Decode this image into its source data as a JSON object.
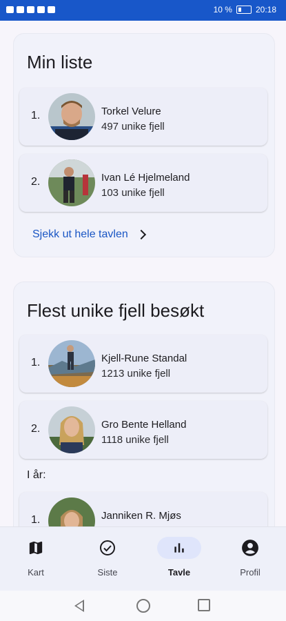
{
  "status_bar": {
    "battery": "10 %",
    "time": "20:18"
  },
  "my_list": {
    "title": "Min liste",
    "rows": [
      {
        "rank": "1.",
        "name": "Torkel Velure",
        "count": "497 unike fjell"
      },
      {
        "rank": "2.",
        "name": "Ivan Lé Hjelmeland",
        "count": "103 unike fjell"
      }
    ],
    "link_label": "Sjekk ut hele tavlen"
  },
  "most_unique": {
    "title": "Flest unike fjell besøkt",
    "rows": [
      {
        "rank": "1.",
        "name": "Kjell-Rune Standal",
        "count": "1213 unike fjell"
      },
      {
        "rank": "2.",
        "name": "Gro Bente Helland",
        "count": "1118 unike fjell"
      }
    ],
    "this_year_label": "I år:",
    "this_year_rows": [
      {
        "rank": "1.",
        "name": "Janniken R. Mjøs",
        "count": ""
      }
    ]
  },
  "bottom_nav": [
    {
      "label": "Kart",
      "icon": "map-icon"
    },
    {
      "label": "Siste",
      "icon": "check-circle-icon"
    },
    {
      "label": "Tavle",
      "icon": "bar-chart-icon",
      "active": true
    },
    {
      "label": "Profil",
      "icon": "account-circle-icon"
    }
  ]
}
